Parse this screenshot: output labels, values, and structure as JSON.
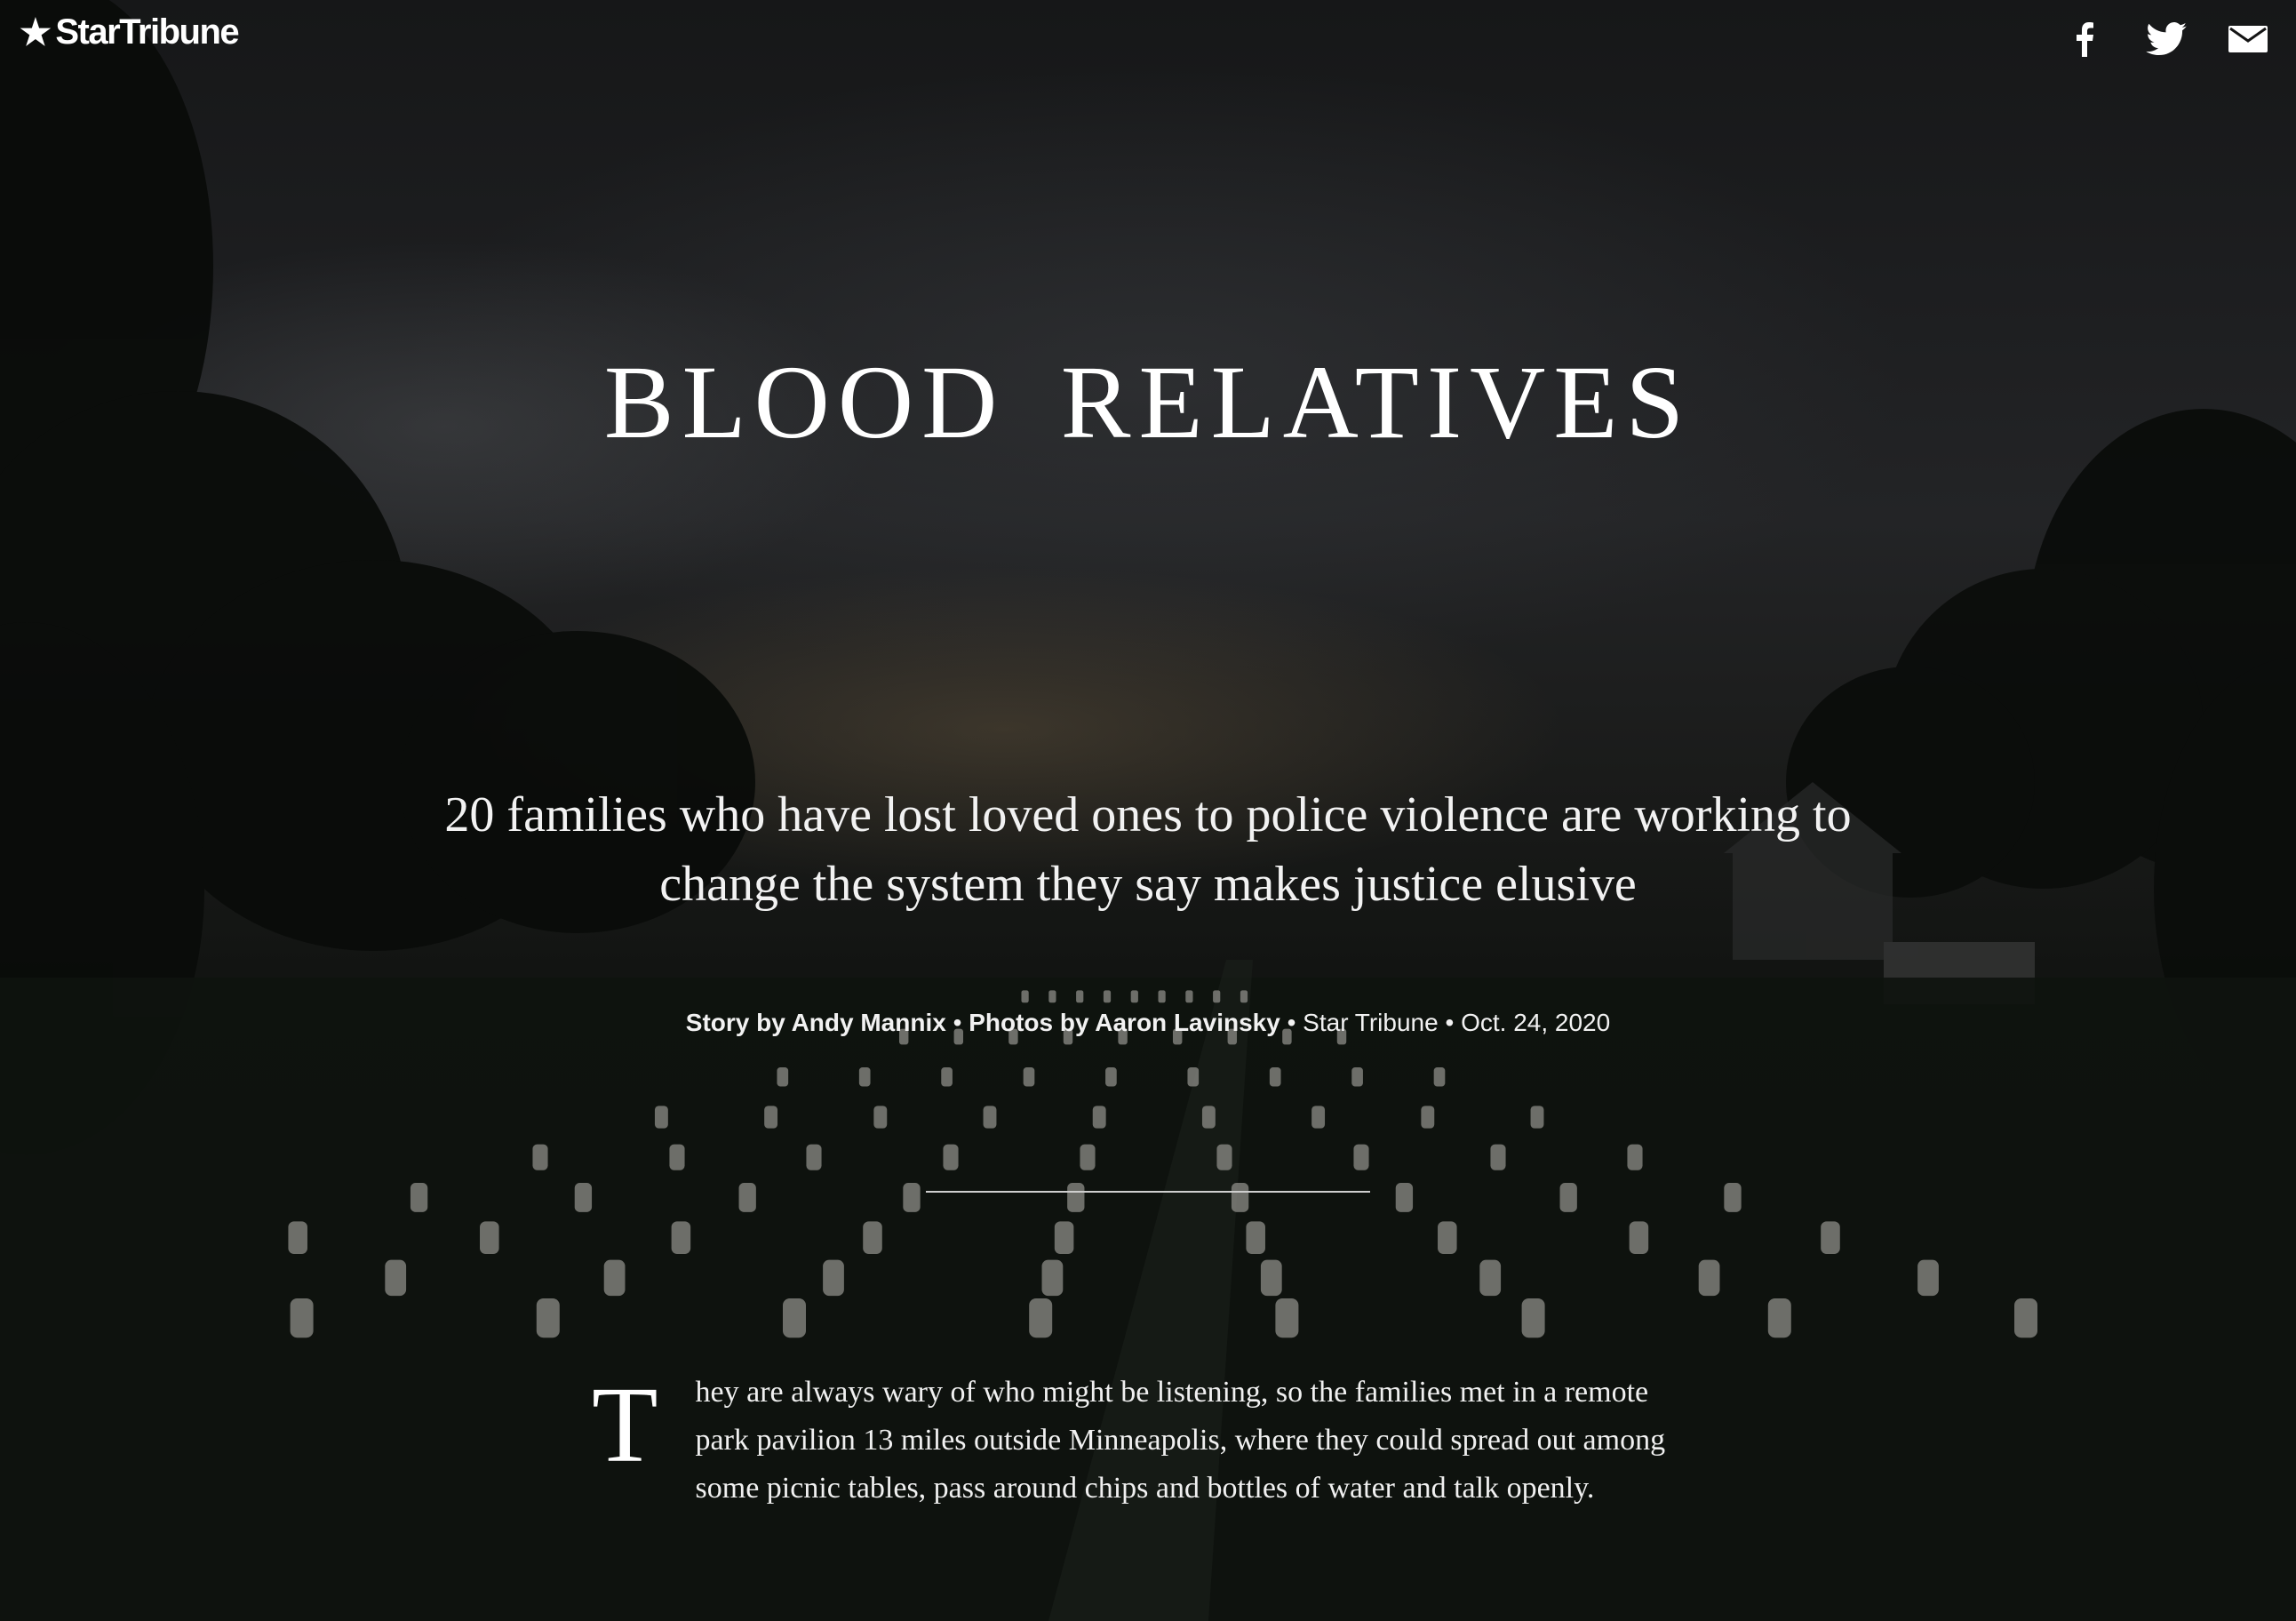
{
  "brand": {
    "name": "StarTribune",
    "logo_icon": "star-icon"
  },
  "share": {
    "facebook_icon": "facebook-icon",
    "twitter_icon": "twitter-icon",
    "email_icon": "email-icon"
  },
  "hero": {
    "title": "BLOOD RELATIVES",
    "dek": "20 families who have lost loved ones to police violence are working to change the system they say makes justice elusive"
  },
  "byline": {
    "story": "Story by Andy Mannix",
    "separator": "•",
    "photos": "Photos by Aaron Lavinsky",
    "publication": "Star Tribune",
    "date": "Oct. 24, 2020"
  },
  "article": {
    "dropcap": "T",
    "first_paragraph": "hey are always wary of who might be listening, so the families met in a remote park pavilion 13 miles outside Minneapolis, where they could spread out among some picnic tables, pass around chips and bottles of water and talk openly."
  },
  "colors": {
    "text": "#ffffff",
    "background": "#0c0d0c",
    "rule": "#cfcfcf"
  }
}
